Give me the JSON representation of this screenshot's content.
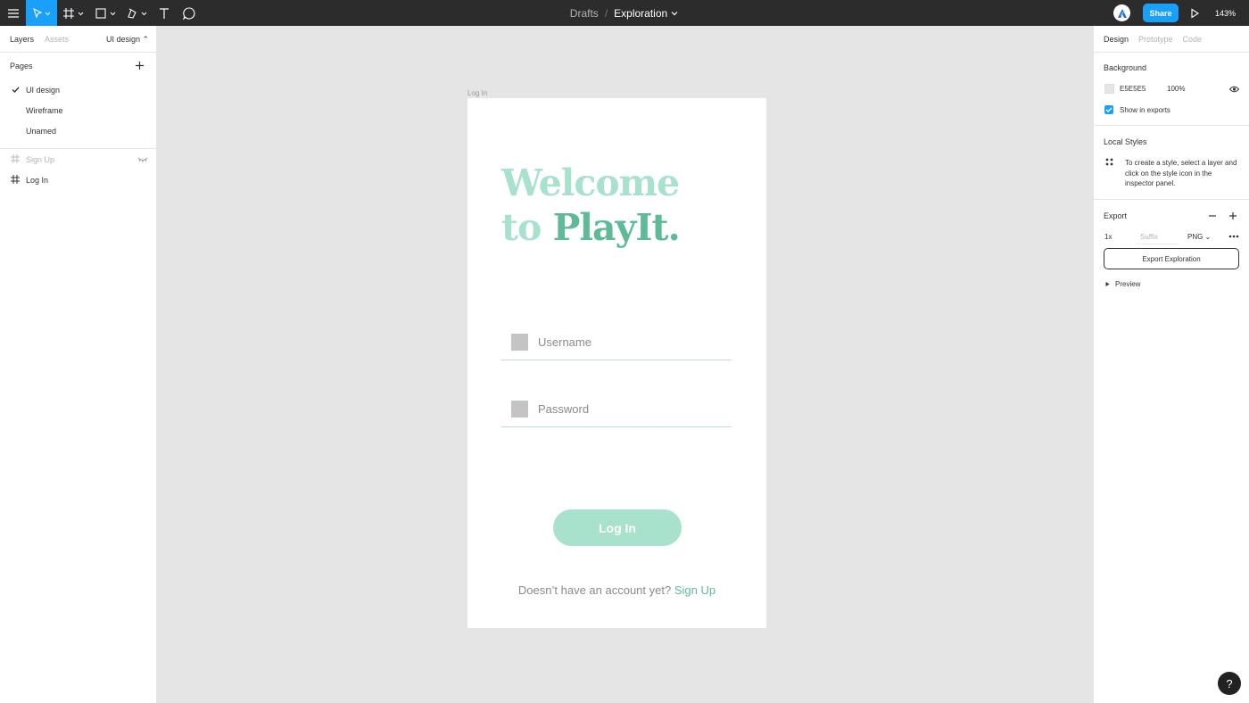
{
  "toolbar": {
    "breadcrumb": "Drafts",
    "separator": "/",
    "file_name": "Exploration",
    "share_label": "Share",
    "zoom": "143%"
  },
  "left_panel": {
    "tabs": [
      "Layers",
      "Assets"
    ],
    "active_tab": "Layers",
    "page_switcher": "UI design ⌃",
    "pages_title": "Pages",
    "pages": [
      {
        "label": "UI design",
        "selected": true
      },
      {
        "label": "Wireframe",
        "selected": false
      },
      {
        "label": "Unamed",
        "selected": false
      }
    ],
    "layers": [
      {
        "label": "Sign Up",
        "hidden": true
      },
      {
        "label": "Log In",
        "hidden": false
      }
    ]
  },
  "canvas": {
    "frame_label": "Log In",
    "headline_line1": "Welcome",
    "headline_to": "to",
    "headline_brand": "PlayIt.",
    "username_placeholder": "Username",
    "password_placeholder": "Password",
    "login_button": "Log In",
    "signup_prompt": "Doesn’t have an account yet?",
    "signup_link": "Sign Up",
    "colors": {
      "accent_light": "#a8e2cc",
      "accent_dark": "#5fba98",
      "canvas_bg": "#e5e5e5"
    }
  },
  "right_panel": {
    "tabs": [
      "Design",
      "Prototype",
      "Code"
    ],
    "active_tab": "Design",
    "background_title": "Background",
    "bg_hex": "E5E5E5",
    "bg_opacity": "100%",
    "show_in_exports": "Show in exports",
    "local_styles_title": "Local Styles",
    "local_styles_hint": "To create a style, select a layer and click on the style icon in the inspector panel.",
    "export_title": "Export",
    "export_scale": "1x",
    "export_suffix_placeholder": "Suffix",
    "export_format": "PNG ⌄",
    "export_button": "Export Exploration",
    "preview_label": "Preview"
  },
  "help_label": "?"
}
